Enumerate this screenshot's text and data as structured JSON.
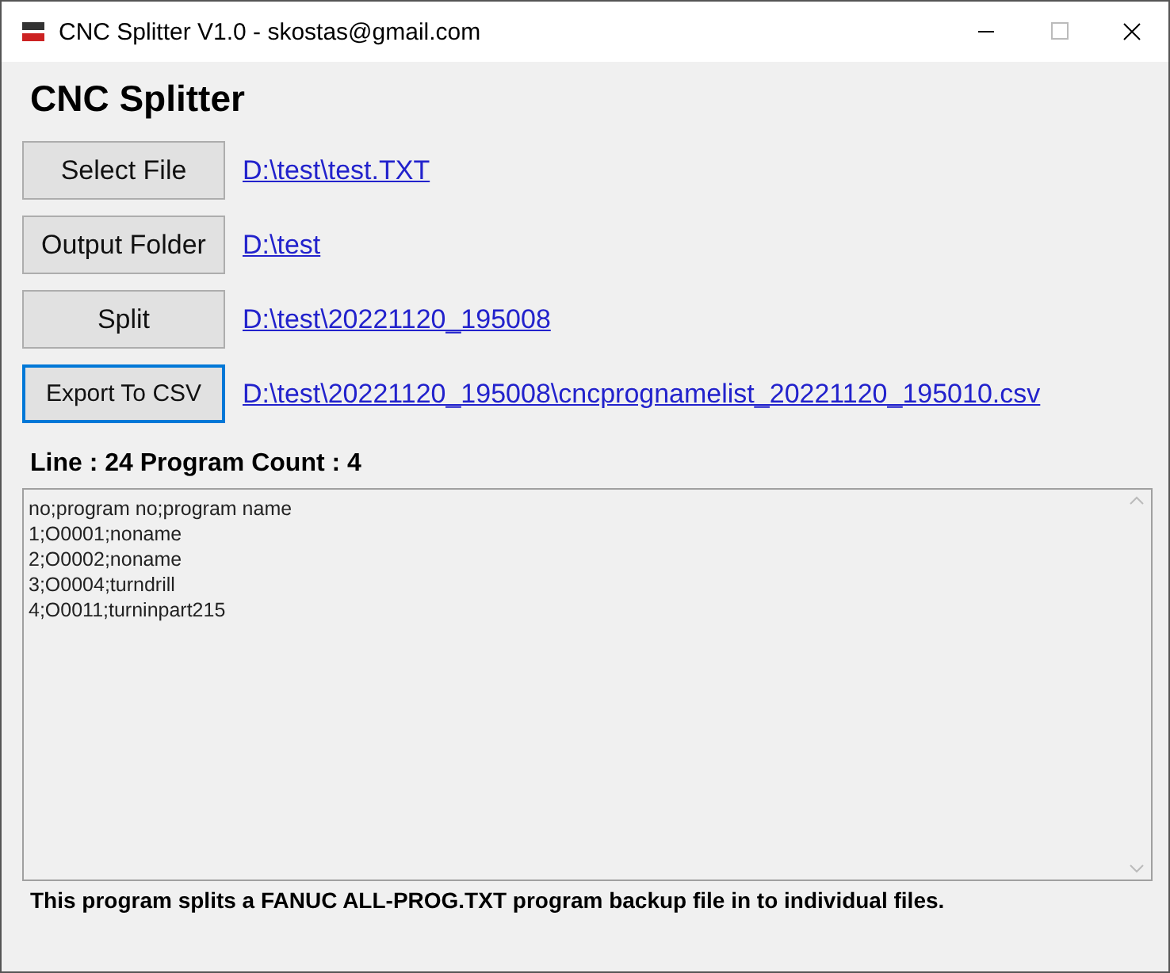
{
  "window": {
    "title": "CNC Splitter V1.0 - skostas@gmail.com"
  },
  "heading": "CNC Splitter",
  "actions": [
    {
      "button": "Select File",
      "focused": false,
      "path": "D:\\test\\test.TXT"
    },
    {
      "button": "Output Folder",
      "focused": false,
      "path": "D:\\test"
    },
    {
      "button": "Split",
      "focused": false,
      "path": "D:\\test\\20221120_195008"
    },
    {
      "button": "Export To CSV",
      "focused": true,
      "path": "D:\\test\\20221120_195008\\cncprognamelist_20221120_195010.csv"
    }
  ],
  "status": "Line : 24 Program Count : 4",
  "output_lines": [
    "no;program no;program name",
    "1;O0001;noname",
    "2;O0002;noname",
    "3;O0004;turndrill",
    "4;O0011;turninpart215"
  ],
  "footer": "This program splits a FANUC ALL-PROG.TXT program backup file in to individual files."
}
